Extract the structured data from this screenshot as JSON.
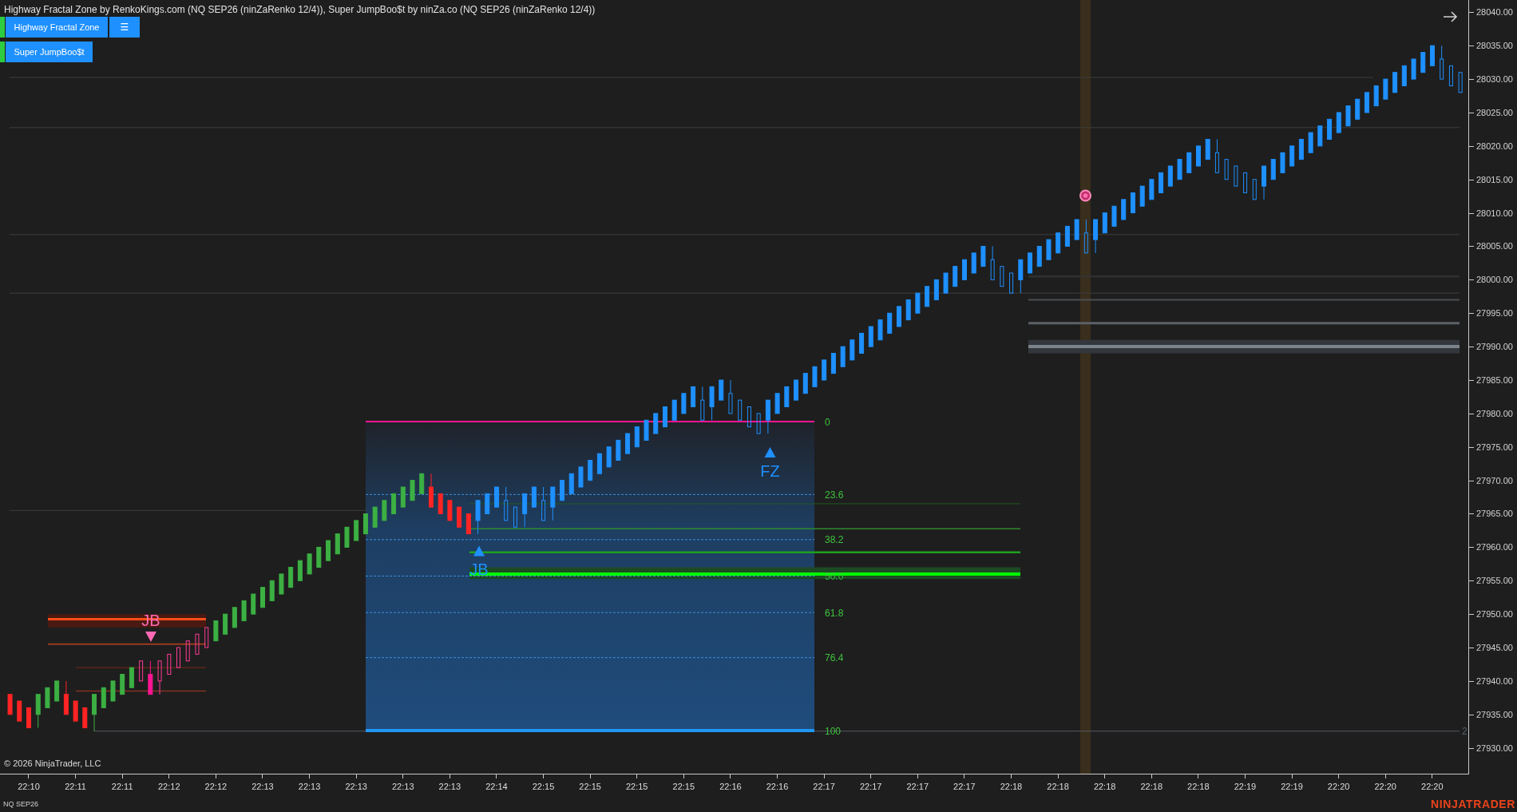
{
  "title": "Highway Fractal Zone by RenkoKings.com (NQ SEP26 (ninZaRenko 12/4)), Super JumpBoo$t by ninZa.co (NQ SEP26 (ninZaRenko 12/4))",
  "indicator_buttons": [
    {
      "label": "Highway Fractal Zone",
      "on": true,
      "menu": "☰"
    },
    {
      "label": "Super JumpBoo$t",
      "on": true
    }
  ],
  "chart_data": {
    "type": "candlestick",
    "categories": [
      null,
      null,
      "22:10",
      null,
      null,
      null,
      null,
      "22:11",
      null,
      null,
      null,
      null,
      "22:11",
      null,
      null,
      null,
      null,
      "22:12",
      null,
      null,
      null,
      null,
      "22:12",
      null,
      null,
      null,
      null,
      "22:13",
      null,
      null,
      null,
      null,
      "22:13",
      null,
      null,
      null,
      null,
      "22:13",
      null,
      null,
      null,
      null,
      "22:13",
      null,
      null,
      null,
      null,
      "22:13",
      null,
      null,
      null,
      null,
      "22:14",
      null,
      null,
      null,
      null,
      "22:15",
      null,
      null,
      null,
      null,
      "22:15",
      null,
      null,
      null,
      null,
      "22:15",
      null,
      null,
      null,
      null,
      "22:15",
      null,
      null,
      null,
      null,
      "22:16",
      null,
      null,
      null,
      null,
      "22:16",
      null,
      null,
      null,
      null,
      "22:17",
      null,
      null,
      null,
      null,
      "22:17",
      null,
      null,
      null,
      null,
      "22:17",
      null,
      null,
      null,
      null,
      "22:17",
      null,
      null,
      null,
      null,
      "22:18",
      null,
      null,
      null,
      null,
      "22:18",
      null,
      null,
      null,
      null,
      "22:18",
      null,
      null,
      null,
      null,
      "22:18",
      null,
      null,
      null,
      null,
      "22:18",
      null,
      null,
      null,
      null,
      "22:19",
      null,
      null,
      null,
      null,
      "22:19",
      null,
      null,
      null,
      null,
      "22:20",
      null,
      null,
      null,
      null,
      "22:20",
      null,
      null,
      null,
      null,
      "22:20",
      null,
      null,
      null
    ],
    "series": [
      {
        "color": "#3cb043",
        "ohlc": [
          null,
          null,
          null,
          [
            27935,
            27938,
            27933,
            27938
          ],
          [
            27936,
            27939,
            27936,
            27939
          ],
          [
            27937,
            27940,
            27937,
            27940
          ],
          null,
          null,
          null,
          [
            27935,
            27938,
            27932.5,
            27938
          ],
          [
            27936,
            27939,
            27936,
            27939
          ],
          [
            27937,
            27940,
            27937,
            27940
          ],
          [
            27938,
            27941,
            27938,
            27941
          ],
          [
            27939,
            27942,
            27939,
            27942
          ],
          null,
          null,
          null,
          null,
          null,
          null,
          null,
          null,
          [
            27946,
            27949,
            27946,
            27949
          ],
          [
            27947,
            27950,
            27947,
            27950
          ],
          [
            27948,
            27951,
            27948,
            27951
          ],
          [
            27949,
            27952,
            27949,
            27952
          ],
          [
            27950,
            27953,
            27950,
            27953
          ],
          [
            27951,
            27954,
            27951,
            27954
          ],
          [
            27952,
            27955,
            27952,
            27955
          ],
          [
            27953,
            27956,
            27953,
            27956
          ],
          [
            27954,
            27957,
            27954,
            27957
          ],
          [
            27955,
            27958,
            27955,
            27958
          ],
          [
            27956,
            27959,
            27956,
            27959
          ],
          [
            27957,
            27960,
            27957,
            27960
          ],
          [
            27958,
            27961,
            27958,
            27961
          ],
          [
            27959,
            27962,
            27959,
            27962
          ],
          [
            27960,
            27963,
            27960,
            27963
          ],
          [
            27961,
            27964,
            27961,
            27964
          ],
          [
            27962,
            27965,
            27962,
            27965
          ],
          [
            27963,
            27966,
            27963,
            27966
          ],
          [
            27964,
            27967,
            27964,
            27967
          ],
          [
            27965,
            27968,
            27965,
            27968
          ],
          [
            27966,
            27969,
            27966,
            27969
          ],
          [
            27967,
            27970,
            27967,
            27970
          ],
          [
            27968,
            27971,
            27968,
            27971
          ],
          null,
          null,
          null,
          null,
          null,
          null,
          null,
          null,
          null,
          null,
          null,
          null,
          null,
          null,
          null,
          null,
          null,
          null,
          null,
          null,
          null,
          null,
          null,
          null,
          null,
          null,
          null,
          null,
          null,
          null,
          null,
          null,
          null,
          null,
          null,
          null,
          null,
          null,
          null,
          null,
          null,
          null,
          null,
          null,
          null,
          null,
          null,
          null,
          null,
          null,
          null,
          null,
          null,
          null,
          null,
          null,
          null,
          null,
          null,
          null,
          null,
          null,
          null,
          null,
          null,
          null,
          null,
          null,
          null,
          null,
          null,
          null,
          null,
          null,
          null,
          null,
          null,
          null,
          null,
          null,
          null,
          null,
          null,
          null,
          null,
          null,
          null,
          null,
          null,
          null,
          null,
          null,
          null,
          null,
          null,
          null,
          null,
          null,
          null,
          null,
          null,
          null,
          null,
          null,
          null,
          null,
          null,
          null,
          null,
          null,
          null
        ]
      },
      {
        "color": "#ff2424",
        "ohlc": [
          [
            27938,
            27938,
            27935,
            27935
          ],
          [
            27937,
            27937,
            27934,
            27934
          ],
          [
            27936,
            27936,
            27933,
            27933
          ],
          null,
          null,
          null,
          [
            27938,
            27940,
            27935,
            27935
          ],
          [
            27937,
            27937,
            27934,
            27934
          ],
          [
            27936,
            27936,
            27933,
            27933
          ],
          null,
          null,
          null,
          null,
          null,
          null,
          null,
          null,
          null,
          null,
          null,
          null,
          null,
          null,
          null,
          null,
          null,
          null,
          null,
          null,
          null,
          null,
          null,
          null,
          null,
          null,
          null,
          null,
          null,
          null,
          null,
          null,
          null,
          null,
          null,
          null,
          [
            27969,
            27971,
            27966,
            27966
          ],
          [
            27968,
            27968,
            27965,
            27965
          ],
          [
            27967,
            27967,
            27964,
            27964
          ],
          [
            27966,
            27966,
            27963,
            27963
          ],
          [
            27965,
            27965,
            27962,
            27962
          ],
          null,
          null,
          null,
          null,
          null,
          null,
          null,
          null,
          null,
          null,
          null,
          null,
          null,
          null,
          null,
          null,
          null,
          null,
          null,
          null,
          null,
          null,
          null,
          null,
          null,
          null,
          null,
          null,
          null,
          null,
          null,
          null,
          null,
          null,
          null,
          null,
          null,
          null,
          null,
          null,
          null,
          null,
          null,
          null,
          null,
          null,
          null,
          null,
          null,
          null,
          null,
          null,
          null,
          null,
          null,
          null,
          null,
          null,
          null,
          null,
          null,
          null,
          null,
          null,
          null,
          null,
          null,
          null,
          null,
          null,
          null,
          null,
          null,
          null,
          null,
          null,
          null,
          null,
          null,
          null,
          null,
          null,
          null,
          null,
          null,
          null,
          null,
          null,
          null,
          null,
          null,
          null,
          null,
          null,
          null,
          null,
          null,
          null,
          null,
          null,
          null,
          null,
          null,
          null,
          null,
          null
        ]
      },
      {
        "color": "#ff3c96",
        "ohlc": [
          null,
          null,
          null,
          null,
          null,
          null,
          null,
          null,
          null,
          null,
          null,
          null,
          null,
          null,
          [
            27940,
            27943,
            27940,
            27943
          ],
          null,
          [
            27940,
            27943,
            27938,
            27943
          ],
          [
            27941,
            27944,
            27941,
            27944
          ],
          [
            27942,
            27945,
            27942,
            27945
          ],
          [
            27943,
            27946,
            27943,
            27946
          ],
          [
            27944,
            27947,
            27944,
            27947
          ],
          [
            27945,
            27948,
            27945,
            27948
          ],
          null,
          null,
          null,
          null,
          null,
          null,
          null,
          null,
          null,
          null,
          null,
          null,
          null,
          null,
          null,
          null,
          null,
          null,
          null,
          null,
          null,
          null,
          null,
          null,
          null,
          null,
          null,
          null,
          null,
          null,
          null,
          null,
          null,
          null,
          null,
          null,
          null,
          null,
          null,
          null,
          null,
          null,
          null,
          null,
          null,
          null,
          null,
          null,
          null,
          null,
          null,
          null,
          null,
          null,
          null,
          null,
          null,
          null,
          null,
          null,
          null,
          null,
          null,
          null,
          null,
          null,
          null,
          null,
          null,
          null,
          null,
          null,
          null,
          null,
          null,
          null,
          null,
          null,
          null,
          null,
          null,
          null,
          null,
          null,
          null,
          null,
          null,
          null,
          null,
          null,
          null,
          null,
          null,
          null,
          null,
          null,
          null,
          null,
          null,
          null,
          null,
          null,
          null,
          null,
          null,
          null,
          null,
          null,
          null,
          null,
          null,
          null,
          null,
          null,
          null,
          null,
          null,
          null,
          null,
          null,
          null,
          null,
          null,
          null,
          null,
          null,
          null,
          null,
          null,
          null,
          null,
          null,
          null,
          null
        ]
      },
      {
        "color": "#ff1493",
        "ohlc": [
          null,
          null,
          null,
          null,
          null,
          null,
          null,
          null,
          null,
          null,
          null,
          null,
          null,
          null,
          null,
          [
            27941,
            27943,
            27938,
            27938
          ],
          null,
          null,
          null,
          null,
          null,
          null,
          null,
          null,
          null,
          null,
          null,
          null,
          null,
          null,
          null,
          null,
          null,
          null,
          null,
          null,
          null,
          null,
          null,
          null,
          null,
          null,
          null,
          null,
          null,
          null,
          null,
          null,
          null,
          null,
          null,
          null,
          null,
          null,
          null,
          null,
          null,
          null,
          null,
          null,
          null,
          null,
          null,
          null,
          null,
          null,
          null,
          null,
          null,
          null,
          null,
          null,
          null,
          null,
          null,
          null,
          null,
          null,
          null,
          null,
          null,
          null,
          null,
          null,
          null,
          null,
          null,
          null,
          null,
          null,
          null,
          null,
          null,
          null,
          null,
          null,
          null,
          null,
          null,
          null,
          null,
          null,
          null,
          null,
          null,
          null,
          null,
          null,
          null,
          null,
          null,
          null,
          null,
          null,
          null,
          null,
          null,
          null,
          null,
          null,
          null,
          null,
          null,
          null,
          null,
          null,
          null,
          null,
          null,
          null,
          null,
          null,
          null,
          null,
          null,
          null,
          null,
          null,
          null,
          null,
          null,
          null,
          null,
          null,
          null,
          null,
          null,
          null,
          null,
          null,
          null,
          null,
          null,
          null,
          null,
          null
        ]
      },
      {
        "color": "#1e90ff",
        "ohlc": [
          null,
          null,
          null,
          null,
          null,
          null,
          null,
          null,
          null,
          null,
          null,
          null,
          null,
          null,
          null,
          null,
          null,
          null,
          null,
          null,
          null,
          null,
          null,
          null,
          null,
          null,
          null,
          null,
          null,
          null,
          null,
          null,
          null,
          null,
          null,
          null,
          null,
          null,
          null,
          null,
          null,
          null,
          null,
          null,
          null,
          null,
          null,
          null,
          null,
          null,
          [
            27964,
            27967,
            27962,
            27967
          ],
          [
            27965,
            27968,
            27965,
            27968
          ],
          [
            27966,
            27969,
            27966,
            27969
          ],
          null,
          null,
          [
            27965,
            27968,
            27963,
            27968
          ],
          [
            27966,
            27969,
            27966,
            27969
          ],
          null,
          [
            27966,
            27969,
            27964,
            27969
          ],
          [
            27967,
            27970,
            27967,
            27970
          ],
          [
            27968,
            27971,
            27968,
            27971
          ],
          [
            27969,
            27972,
            27969,
            27972
          ],
          [
            27970,
            27973,
            27970,
            27973
          ],
          [
            27971,
            27974,
            27971,
            27974
          ],
          [
            27972,
            27975,
            27972,
            27975
          ],
          [
            27973,
            27976,
            27973,
            27976
          ],
          [
            27974,
            27977,
            27974,
            27977
          ],
          [
            27975,
            27978,
            27975,
            27978
          ],
          [
            27976,
            27979,
            27976,
            27979
          ],
          [
            27977,
            27980,
            27977,
            27980
          ],
          [
            27978,
            27981,
            27978,
            27981
          ],
          [
            27979,
            27982,
            27979,
            27982
          ],
          [
            27980,
            27983,
            27980,
            27983
          ],
          [
            27981,
            27984,
            27981,
            27984
          ],
          null,
          [
            27981,
            27984,
            27979,
            27984
          ],
          [
            27982,
            27985,
            27982,
            27985
          ],
          null,
          null,
          null,
          null,
          [
            27979,
            27982,
            27977,
            27982
          ],
          [
            27980,
            27983,
            27980,
            27983
          ],
          [
            27981,
            27984,
            27981,
            27984
          ],
          [
            27982,
            27985,
            27982,
            27985
          ],
          [
            27983,
            27986,
            27983,
            27986
          ],
          [
            27984,
            27987,
            27984,
            27987
          ],
          [
            27985,
            27988,
            27985,
            27988
          ],
          [
            27986,
            27989,
            27986,
            27989
          ],
          [
            27987,
            27990,
            27987,
            27990
          ],
          [
            27988,
            27991,
            27988,
            27991
          ],
          [
            27989,
            27992,
            27989,
            27992
          ],
          [
            27990,
            27993,
            27990,
            27993
          ],
          [
            27991,
            27994,
            27991,
            27994
          ],
          [
            27992,
            27995,
            27992,
            27995
          ],
          [
            27993,
            27996,
            27993,
            27996
          ],
          [
            27994,
            27997,
            27994,
            27997
          ],
          [
            27995,
            27998,
            27995,
            27998
          ],
          [
            27996,
            27999,
            27996,
            27999
          ],
          [
            27997,
            28000,
            27997,
            28000
          ],
          [
            27998,
            28001,
            27998,
            28001
          ],
          [
            27999,
            28002,
            27999,
            28002
          ],
          [
            28000,
            28003,
            28000,
            28003
          ],
          [
            28001,
            28004,
            28001,
            28004
          ],
          [
            28002,
            28005,
            28002,
            28005
          ],
          null,
          null,
          null,
          [
            28000,
            28003,
            27998,
            28003
          ],
          [
            28001,
            28004,
            28001,
            28004
          ],
          [
            28002,
            28005,
            28002,
            28005
          ],
          [
            28003,
            28006,
            28003,
            28006
          ],
          [
            28004,
            28007,
            28004,
            28007
          ],
          [
            28005,
            28008,
            28005,
            28008
          ],
          [
            28006,
            28009,
            28006,
            28009
          ],
          null,
          [
            28006,
            28009,
            28004,
            28009
          ],
          [
            28007,
            28010,
            28007,
            28010
          ],
          [
            28008,
            28011,
            28008,
            28011
          ],
          [
            28009,
            28012,
            28009,
            28012
          ],
          [
            28010,
            28013,
            28010,
            28013
          ],
          [
            28011,
            28014,
            28011,
            28014
          ],
          [
            28012,
            28015,
            28012,
            28015
          ],
          [
            28013,
            28016,
            28013,
            28016
          ],
          [
            28014,
            28017,
            28014,
            28017
          ],
          [
            28015,
            28018,
            28015,
            28018
          ],
          [
            28016,
            28019,
            28016,
            28019
          ],
          [
            28017,
            28020,
            28017,
            28020
          ],
          [
            28018,
            28021,
            28018,
            28021
          ],
          null,
          null,
          null,
          null,
          null,
          [
            28014,
            28017,
            28012,
            28017
          ],
          [
            28015,
            28018,
            28015,
            28018
          ],
          [
            28016,
            28019,
            28016,
            28019
          ],
          [
            28017,
            28020,
            28017,
            28020
          ],
          [
            28018,
            28021,
            28018,
            28021
          ],
          [
            28019,
            28022,
            28019,
            28022
          ],
          [
            28020,
            28023,
            28020,
            28023
          ],
          [
            28021,
            28024,
            28021,
            28024
          ],
          [
            28022,
            28025,
            28022,
            28025
          ],
          [
            28023,
            28026,
            28023,
            28026
          ],
          [
            28024,
            28027,
            28024,
            28027
          ],
          [
            28025,
            28028,
            28025,
            28028
          ],
          [
            28026,
            28029,
            28026,
            28029
          ],
          [
            28027,
            28030,
            28027,
            28030
          ],
          [
            28028,
            28031,
            28028,
            28031
          ],
          [
            28029,
            28032,
            28029,
            28032
          ],
          [
            28030,
            28033,
            28030,
            28033
          ],
          [
            28031,
            28034,
            28031,
            28034
          ],
          [
            28032,
            28035,
            28032,
            28035
          ],
          null,
          null,
          null
        ]
      },
      {
        "color": "#1e90ff",
        "ohlc": [
          null,
          null,
          null,
          null,
          null,
          null,
          null,
          null,
          null,
          null,
          null,
          null,
          null,
          null,
          null,
          null,
          null,
          null,
          null,
          null,
          null,
          null,
          null,
          null,
          null,
          null,
          null,
          null,
          null,
          null,
          null,
          null,
          null,
          null,
          null,
          null,
          null,
          null,
          null,
          null,
          null,
          null,
          null,
          null,
          null,
          null,
          null,
          null,
          null,
          null,
          null,
          null,
          null,
          [
            27967,
            27969,
            27964,
            27964
          ],
          [
            27966,
            27966,
            27963,
            27963
          ],
          null,
          null,
          [
            27967,
            27969,
            27964,
            27964
          ],
          null,
          null,
          null,
          null,
          null,
          null,
          null,
          null,
          null,
          null,
          null,
          null,
          null,
          null,
          null,
          null,
          [
            27982,
            27984,
            27979,
            27979
          ],
          null,
          null,
          [
            27983,
            27985,
            27980,
            27980
          ],
          [
            27982,
            27982,
            27979,
            27979
          ],
          [
            27981,
            27981,
            27978,
            27978
          ],
          [
            27980,
            27980,
            27977,
            27977
          ],
          null,
          null,
          null,
          null,
          null,
          null,
          null,
          null,
          null,
          null,
          null,
          null,
          null,
          null,
          null,
          null,
          null,
          null,
          null,
          null,
          null,
          null,
          null,
          null,
          [
            28003,
            28005,
            28000,
            28000
          ],
          [
            28002,
            28002,
            27999,
            27999
          ],
          [
            28001,
            28001,
            27998,
            27998
          ],
          null,
          null,
          null,
          null,
          null,
          null,
          null,
          [
            28007,
            28009,
            28004,
            28004
          ],
          null,
          null,
          null,
          null,
          null,
          null,
          null,
          null,
          null,
          null,
          null,
          null,
          null,
          [
            28019,
            28021,
            28016,
            28016
          ],
          [
            28018,
            28018,
            28015,
            28015
          ],
          [
            28017,
            28017,
            28014,
            28014
          ],
          [
            28016,
            28016,
            28013,
            28013
          ],
          [
            28015,
            28015,
            28012,
            28012
          ],
          null,
          null,
          null,
          null,
          null,
          null,
          null,
          null,
          null,
          null,
          null,
          null,
          null,
          null,
          null,
          null,
          null,
          null,
          null,
          [
            28033,
            28035,
            28030,
            28030
          ],
          [
            28032,
            28032,
            28029,
            28029
          ],
          [
            28031,
            28031,
            28028,
            28028
          ]
        ]
      }
    ],
    "ylim": [
      27926.14,
      28041.83
    ],
    "yticks": [
      {
        "value": 28040,
        "label": "28040.00"
      },
      {
        "value": 28035,
        "label": "28035.00"
      },
      {
        "value": 28030,
        "label": "28030.00"
      },
      {
        "value": 28025,
        "label": "28025.00"
      },
      {
        "value": 28020,
        "label": "28020.00"
      },
      {
        "value": 28015,
        "label": "28015.00"
      },
      {
        "value": 28010,
        "label": "28010.00"
      },
      {
        "value": 28005,
        "label": "28005.00"
      },
      {
        "value": 28000,
        "label": "28000.00"
      },
      {
        "value": 27995,
        "label": "27995.00"
      },
      {
        "value": 27990,
        "label": "27990.00"
      },
      {
        "value": 27985,
        "label": "27985.00"
      },
      {
        "value": 27980,
        "label": "27980.00"
      },
      {
        "value": 27975,
        "label": "27975.00"
      },
      {
        "value": 27970,
        "label": "27970.00"
      },
      {
        "value": 27965,
        "label": "27965.00"
      },
      {
        "value": 27960,
        "label": "27960.00"
      },
      {
        "value": 27955,
        "label": "27955.00"
      },
      {
        "value": 27950,
        "label": "27950.00"
      },
      {
        "value": 27945,
        "label": "27945.00"
      },
      {
        "value": 27940,
        "label": "27940.00"
      },
      {
        "value": 27935,
        "label": "27935.00"
      },
      {
        "value": 27930,
        "label": "27930.00"
      }
    ],
    "bands": [
      {
        "axis": "y",
        "from": 27989.0,
        "to": 27991.0,
        "color": "#33373d"
      },
      {
        "axis": "y",
        "from": 27955.25,
        "to": 27957.0,
        "color": "#1d4a24"
      },
      {
        "axis": "y",
        "from": 27948.0,
        "to": 27950.0,
        "color": "#4a1a12"
      }
    ],
    "ref_lines": [
      {
        "axis": "y",
        "value": 28030.25,
        "color": "#3e3e3e"
      },
      {
        "axis": "y",
        "value": 28022.75,
        "color": "#3e3e3e"
      },
      {
        "axis": "y",
        "value": 28006.75,
        "color": "#3e3e3e"
      },
      {
        "axis": "y",
        "value": 27998.0,
        "color": "#3e3e3e"
      },
      {
        "axis": "y",
        "value": 27965.5,
        "color": "#3e3e3e"
      },
      {
        "axis": "y",
        "value": 27932.5,
        "color": "#555b63"
      },
      {
        "axis": "y",
        "value": 28000.5,
        "color": "#343434"
      },
      {
        "axis": "y",
        "value": 27997.0,
        "color": "#4b4e52"
      },
      {
        "axis": "y",
        "value": 27993.5,
        "color": "#5c6168"
      },
      {
        "axis": "y",
        "value": 27990.0,
        "color": "#7a838c"
      },
      {
        "axis": "y",
        "value": 27966.5,
        "color": "#1f5c1f"
      },
      {
        "axis": "y",
        "value": 27962.75,
        "color": "#2e8b2e"
      },
      {
        "axis": "y",
        "value": 27959.25,
        "color": "#1fa01f"
      },
      {
        "axis": "y",
        "value": 27956.0,
        "color": "#00ff00"
      },
      {
        "axis": "y",
        "value": 27949.25,
        "color": "#ff4d1a"
      },
      {
        "axis": "y",
        "value": 27945.5,
        "color": "#9a3a1e"
      },
      {
        "axis": "y",
        "value": 27942.0,
        "color": "#7a2a1a"
      },
      {
        "axis": "y",
        "value": 27938.5,
        "color": "#843222"
      }
    ]
  },
  "candle_styles": [
    {
      "kind": "solid"
    },
    {
      "kind": "solid"
    },
    {
      "kind": "hollow"
    },
    {
      "kind": "solid"
    },
    {
      "kind": "solid"
    },
    {
      "kind": "hollow"
    }
  ],
  "signals": [
    {
      "kind": "down",
      "label": "JB",
      "color": "#ff69b4"
    },
    {
      "kind": "up",
      "label": "JB",
      "color": "#1e90ff"
    },
    {
      "kind": "up",
      "label": "FZ",
      "color": "#1e90ff"
    }
  ],
  "fib_levels": [
    "0",
    "23.6",
    "38.2",
    "50.0",
    "61.8",
    "76.4",
    "100"
  ],
  "line_tag": "2",
  "copyright": "© 2026 NinjaTrader, LLC",
  "instrument": "NQ SEP26",
  "logo": "NINJATRADER"
}
